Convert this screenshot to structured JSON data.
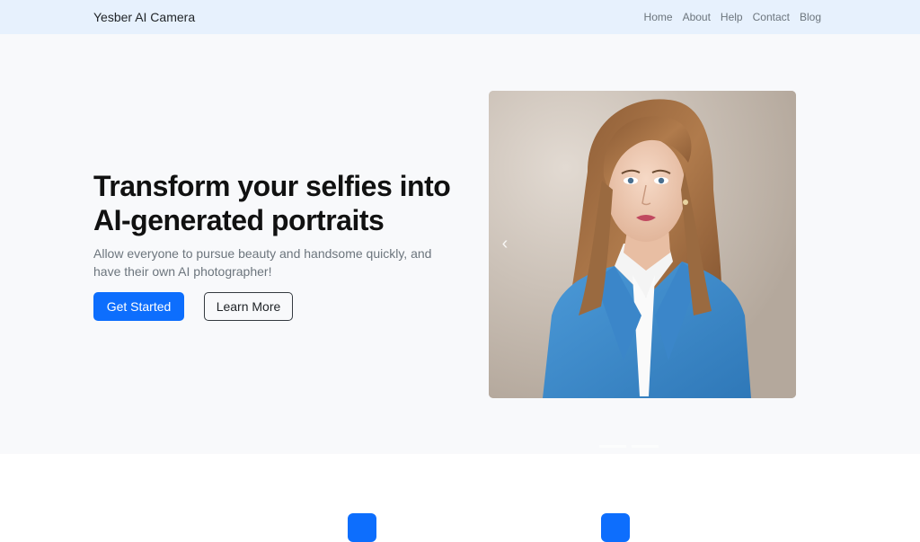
{
  "nav": {
    "brand": "Yesber AI Camera",
    "links": [
      "Home",
      "About",
      "Help",
      "Contact",
      "Blog"
    ]
  },
  "hero": {
    "title_line1": "Transform your selfies into",
    "title_line2": "AI-generated portraits",
    "subtitle": "Allow everyone to pursue beauty and handsome quickly, and have their own AI photographer!",
    "primary_button": "Get Started",
    "secondary_button": "Learn More"
  },
  "carousel": {
    "prev_icon": "chevron-left-icon",
    "image_subject": "portrait-photo"
  },
  "colors": {
    "navbar_bg": "#e7f1fd",
    "hero_bg": "#f8f9fb",
    "primary": "#0d6efd"
  }
}
